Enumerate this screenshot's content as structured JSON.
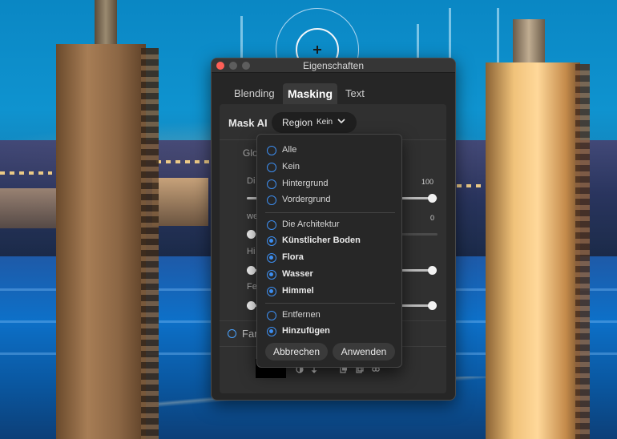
{
  "window": {
    "title": "Eigenschaften"
  },
  "tabs": [
    {
      "label": "Blending",
      "active": false
    },
    {
      "label": "Masking",
      "active": true
    },
    {
      "label": "Text",
      "active": false
    }
  ],
  "mask_ai": {
    "label": "Mask AI",
    "region_label": "Region",
    "region_value": "Kein"
  },
  "underlying": {
    "glo_label": "Glo",
    "row1_label": "Di",
    "row1_value": "100",
    "row2_label": "we",
    "row2_value": "0",
    "row3_label": "Hi",
    "row4_label": "Fe",
    "far_label": "Far"
  },
  "dropdown": {
    "group1": [
      {
        "label": "Alle",
        "selected": false
      },
      {
        "label": "Kein",
        "selected": false
      },
      {
        "label": "Hintergrund",
        "selected": false
      },
      {
        "label": "Vordergrund",
        "selected": false
      }
    ],
    "group2": [
      {
        "label": "Die Architektur",
        "selected": false
      },
      {
        "label": "Künstlicher Boden",
        "selected": true
      },
      {
        "label": "Flora",
        "selected": true
      },
      {
        "label": "Wasser",
        "selected": true
      },
      {
        "label": "Himmel",
        "selected": true
      }
    ],
    "group3": [
      {
        "label": "Entfernen",
        "selected": false
      },
      {
        "label": "Hinzufügen",
        "selected": true
      }
    ],
    "cancel_label": "Abbrechen",
    "apply_label": "Anwenden"
  },
  "colors": {
    "accent": "#3d8ef0",
    "panel_bg": "#262626",
    "close": "#ff5f57"
  },
  "icons": [
    "brush-cursor-icon",
    "chevron-down-icon",
    "contrast-icon",
    "brush-tool-icon",
    "paste-icon",
    "copy-icon",
    "link-icon"
  ]
}
